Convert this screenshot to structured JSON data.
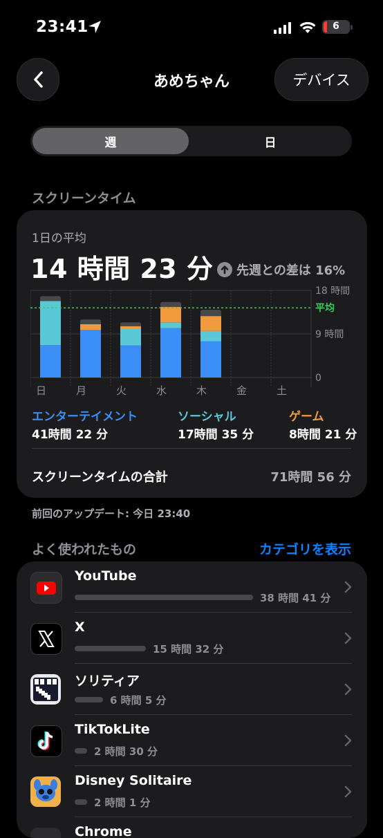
{
  "status": {
    "time": "23:41",
    "battery": "6"
  },
  "nav": {
    "title": "あめちゃん",
    "device_button": "デバイス"
  },
  "segment": {
    "week": "週",
    "day": "日"
  },
  "screen_time": {
    "section_title": "スクリーンタイム",
    "avg_label": "1日の平均",
    "avg_value": "14 時間 23 分",
    "diff_text": "先週との差は 16%",
    "legend": [
      {
        "label": "エンターテイメント",
        "value": "41時間 22 分",
        "color": "#3a8ef6"
      },
      {
        "label": "ソーシャル",
        "value": "17時間 35 分",
        "color": "#5ac8d7"
      },
      {
        "label": "ゲーム",
        "value": "8時間 21 分",
        "color": "#f29b3e"
      }
    ],
    "total_label": "スクリーンタイムの合計",
    "total_value": "71時間 56 分",
    "update_text": "前回のアップデート: 今日 23:40"
  },
  "chart_data": {
    "type": "bar",
    "stacked": true,
    "categories": [
      "日",
      "月",
      "火",
      "水",
      "木",
      "金",
      "土"
    ],
    "series": [
      {
        "name": "エンターテイメント",
        "color": "#3a8ef6",
        "values": [
          6.7,
          9.8,
          6.6,
          10.2,
          7.5,
          0,
          0
        ]
      },
      {
        "name": "ソーシャル",
        "color": "#5ac8d7",
        "values": [
          9.1,
          0,
          3.4,
          1.2,
          2.1,
          0,
          0
        ]
      },
      {
        "name": "ゲーム",
        "color": "#f29b3e",
        "values": [
          0,
          1.2,
          0.6,
          3.2,
          3.1,
          0,
          0
        ]
      },
      {
        "color": "#48484a",
        "values": [
          1.0,
          1.0,
          0.8,
          1.0,
          1.3,
          0,
          0
        ]
      }
    ],
    "ylim": [
      0,
      18
    ],
    "y_ticks": [
      {
        "value": 18,
        "label": "18 時間"
      },
      {
        "value": 9,
        "label": "9 時間"
      },
      {
        "value": 0,
        "label": "0"
      }
    ],
    "average": {
      "value": 14.4,
      "label": "平均",
      "color": "#30d158"
    },
    "grid": true
  },
  "apps": {
    "section_title": "よく使われたもの",
    "show_category": "カテゴリを表示",
    "items": [
      {
        "name": "YouTube",
        "time": "38 時間 41 分",
        "fraction": 1.0,
        "icon": "youtube-icon"
      },
      {
        "name": "X",
        "time": "15 時間 32 分",
        "fraction": 0.4,
        "icon": "x-icon"
      },
      {
        "name": "ソリティア",
        "time": "6 時間 5 分",
        "fraction": 0.16,
        "icon": "solitaire-icon"
      },
      {
        "name": "TikTokLite",
        "time": "2 時間 30 分",
        "fraction": 0.065,
        "icon": "tiktok-icon"
      },
      {
        "name": "Disney Solitaire",
        "time": "2 時間 1 分",
        "fraction": 0.052,
        "icon": "disney-solitaire-icon"
      },
      {
        "name": "Chrome",
        "time": "",
        "fraction": 0,
        "icon": "chrome-icon"
      }
    ]
  }
}
